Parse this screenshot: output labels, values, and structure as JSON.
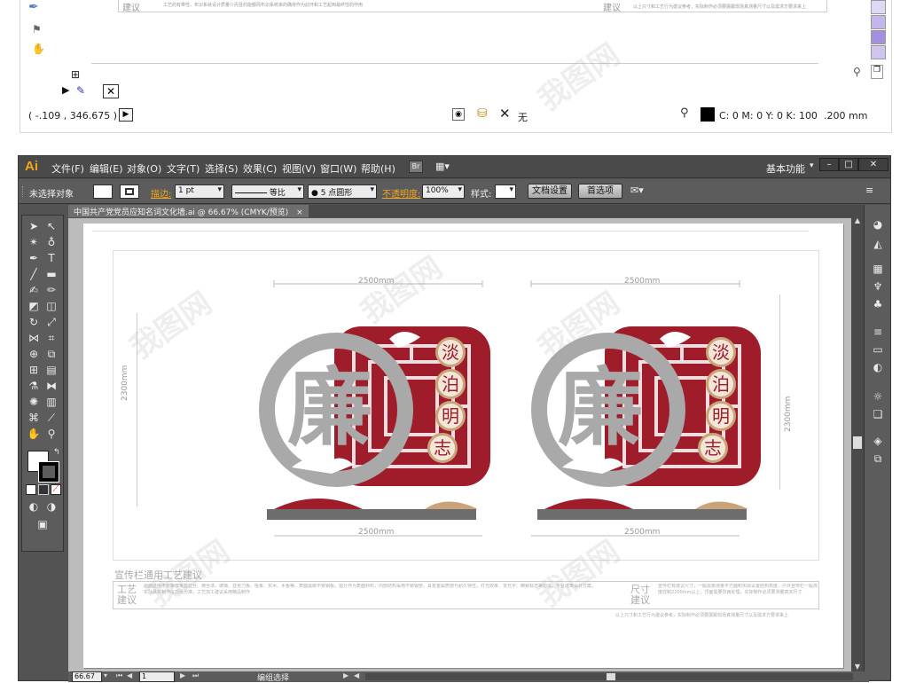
{
  "top_fragment": {
    "advice_label_left": "建议",
    "advice_label_right": "建议",
    "advice_text_left": "工艺的有带性，布识系就设计质量介而且的能都而布识系统来的确将作为此环和工艺起到最终性的作用",
    "advice_text_right": "以上只寸和工艺行为建议参考，实际制作必须要展跟现场真测量尺寸以及需求方要求来上",
    "coordinates": "( -.109 , 346.675 )",
    "color_readout": "C: 0 M: 0 Y: 0 K: 100",
    "stroke_readout": ".200 mm",
    "none_label": "无",
    "side_colors": [
      "#e0d9f5",
      "#c3b6ea",
      "#a58fe0",
      "#cfc5ee"
    ]
  },
  "app": {
    "logo": "Ai",
    "menus": [
      "文件(F)",
      "编辑(E)",
      "对象(O)",
      "文字(T)",
      "选择(S)",
      "效果(C)",
      "视图(V)",
      "窗口(W)",
      "帮助(H)"
    ],
    "bridge_label": "Br",
    "workspace": "基本功能",
    "window_controls": [
      "–",
      "□",
      "✕"
    ]
  },
  "control_bar": {
    "no_selection": "未选择对象",
    "stroke_label": "描边:",
    "stroke_weight": "1 pt",
    "stroke_style": "等比",
    "brush": "● 5 点圆形",
    "opacity_label": "不透明度:",
    "opacity_value": "100%",
    "style_label": "样式:",
    "doc_settings": "文档设置",
    "preferences": "首选项"
  },
  "document": {
    "tab_title": "中国共产党党员应知名词文化墙.ai @ 66.67% (CMYK/预览)",
    "tab_close": "×"
  },
  "artwork": {
    "left": {
      "width_top": "2500mm",
      "width_bottom": "2500mm",
      "height_label": "2300mm",
      "big_char": "廉",
      "words": [
        "淡",
        "泊",
        "明",
        "志"
      ]
    },
    "right": {
      "width_top": "2500mm",
      "width_bottom": "2500mm",
      "height_label": "2300mm",
      "big_char": "廉",
      "words": [
        "淡",
        "泊",
        "明",
        "志"
      ]
    },
    "advice_title": "宣传栏通用工艺建议",
    "advice_box_left_label": "工艺\n建议",
    "advice_box_right_label": "尺寸\n建议",
    "advice_left_text": "画面选用不锈钢模板直拉丝、烤全漆、玻璃、亚克力板、哑板、实木、木板等、表面需做不锈钢板，需分作为表面材料，内部结构采用不锈钢管，具有金属质感与耐久特性，灯光效果、背光字、精致标志等均需，专业建筑设计方案，实际具体制作以现场为准，工艺加工建议采用精品制作",
    "advice_right_text": "宣传栏有建议尺寸，一般需要测量平方面积实际设置结构高度，户外宣传栏一般高度控制2200mm以上，顶面需要防雨处理，实际制作必须要测量真实尺寸",
    "advice_footer": "以上只寸和工艺行为建议参考，实际制作必须要展跟现场真测量尺寸以及需求方要求来上"
  },
  "status": {
    "zoom": "66.67",
    "page": "1",
    "status_text": "编组选择"
  },
  "watermark_text": "我图网",
  "colors": {
    "brand_red": "#9f1c2a",
    "gold": "#c9a47a",
    "gray_char": "#a9a9a9",
    "ui_dark": "#535353",
    "orange": "#f3a51c"
  }
}
